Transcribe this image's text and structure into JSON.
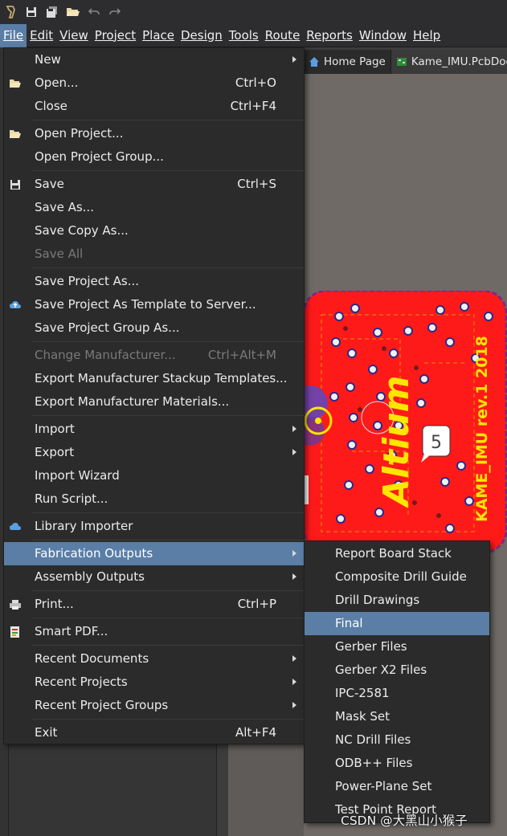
{
  "toolbar": {
    "icons": [
      "app-logo-icon",
      "save-icon",
      "save-all-icon",
      "open-icon",
      "undo-icon",
      "redo-icon"
    ]
  },
  "menubar": {
    "items": [
      "File",
      "Edit",
      "View",
      "Project",
      "Place",
      "Design",
      "Tools",
      "Route",
      "Reports",
      "Window",
      "Help"
    ],
    "active": "File"
  },
  "tabs": [
    {
      "label": "Home Page",
      "icon": "home-icon"
    },
    {
      "label": "Kame_IMU.PcbDoc",
      "icon": "pcb-doc-icon"
    }
  ],
  "file_menu": {
    "new": {
      "label": "New"
    },
    "open": {
      "label": "Open...",
      "shortcut": "Ctrl+O"
    },
    "close": {
      "label": "Close",
      "shortcut": "Ctrl+F4"
    },
    "open_project": {
      "label": "Open Project..."
    },
    "open_project_group": {
      "label": "Open Project Group..."
    },
    "save": {
      "label": "Save",
      "shortcut": "Ctrl+S"
    },
    "save_as": {
      "label": "Save As..."
    },
    "save_copy_as": {
      "label": "Save Copy As..."
    },
    "save_all": {
      "label": "Save All"
    },
    "save_project_as": {
      "label": "Save Project As..."
    },
    "save_project_template": {
      "label": "Save Project As Template to Server..."
    },
    "save_project_group_as": {
      "label": "Save Project Group As..."
    },
    "change_manufacturer": {
      "label": "Change Manufacturer...",
      "shortcut": "Ctrl+Alt+M"
    },
    "export_stackup": {
      "label": "Export Manufacturer Stackup Templates..."
    },
    "export_materials": {
      "label": "Export Manufacturer Materials..."
    },
    "import": {
      "label": "Import"
    },
    "export": {
      "label": "Export"
    },
    "import_wizard": {
      "label": "Import Wizard"
    },
    "run_script": {
      "label": "Run Script..."
    },
    "library_importer": {
      "label": "Library Importer"
    },
    "fabrication_outputs": {
      "label": "Fabrication Outputs"
    },
    "assembly_outputs": {
      "label": "Assembly Outputs"
    },
    "print": {
      "label": "Print...",
      "shortcut": "Ctrl+P"
    },
    "smart_pdf": {
      "label": "Smart PDF..."
    },
    "recent_documents": {
      "label": "Recent Documents"
    },
    "recent_projects": {
      "label": "Recent Projects"
    },
    "recent_project_groups": {
      "label": "Recent Project Groups"
    },
    "exit": {
      "label": "Exit",
      "shortcut": "Alt+F4"
    }
  },
  "fabrication_submenu": [
    "Report Board Stack",
    "Composite Drill Guide",
    "Drill Drawings",
    "Final",
    "Gerber Files",
    "Gerber X2 Files",
    "IPC-2581",
    "Mask Set",
    "NC Drill Files",
    "ODB++ Files",
    "Power-Plane Set",
    "Test Point Report"
  ],
  "fabrication_highlighted": "Final",
  "pcb": {
    "silkscreen_text": "KAME_IMU rev.1 2018",
    "logo_text": "Altium",
    "marker_number": "5"
  },
  "watermark": "CSDN @大黑山小猴子",
  "colors": {
    "highlight": "#5a7ea6",
    "menu_bg": "#2b2b2b",
    "pcb_red": "#ff1a1a",
    "silk_yellow": "#ffe600"
  }
}
